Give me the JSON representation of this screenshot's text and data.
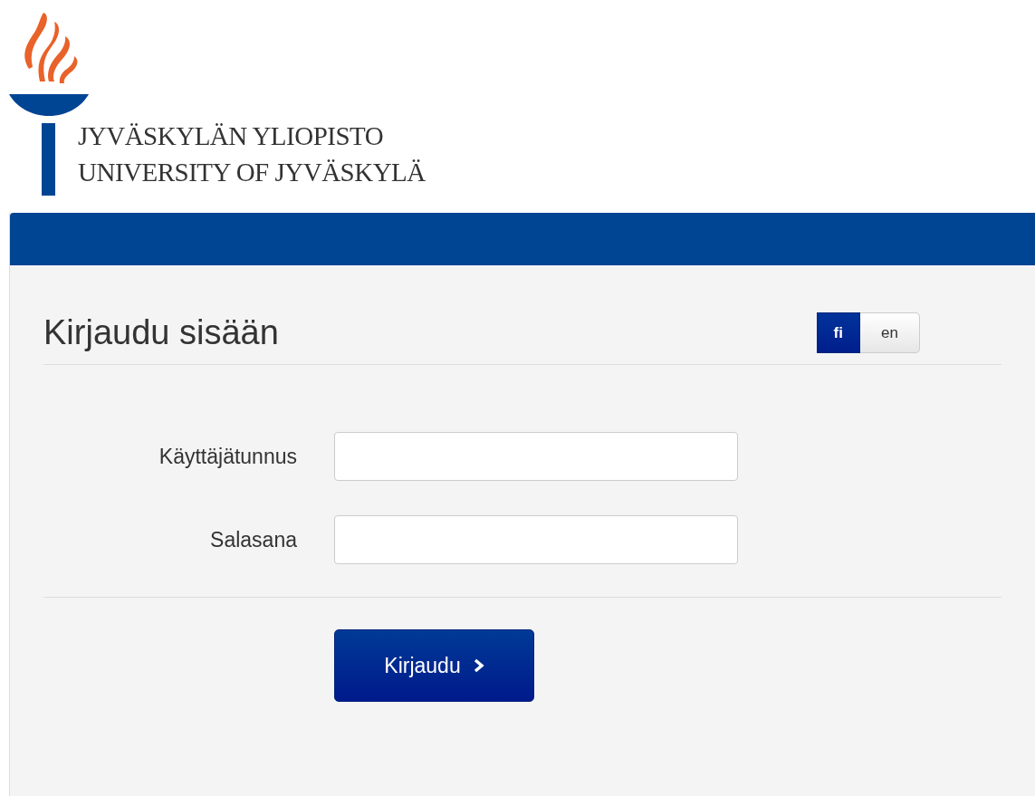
{
  "logo": {
    "lines": [
      "JYVÄSKYLÄN YLIOPISTO",
      "UNIVERSITY OF JYVÄSKYLÄ"
    ]
  },
  "login": {
    "title": "Kirjaudu sisään",
    "languages": [
      {
        "label": "fi",
        "selected": true
      },
      {
        "label": "en",
        "selected": false
      }
    ],
    "fields": [
      {
        "label": "Käyttäjätunnus"
      },
      {
        "label": "Salasana"
      }
    ],
    "submit": {
      "label": "Kirjaudu"
    }
  }
}
